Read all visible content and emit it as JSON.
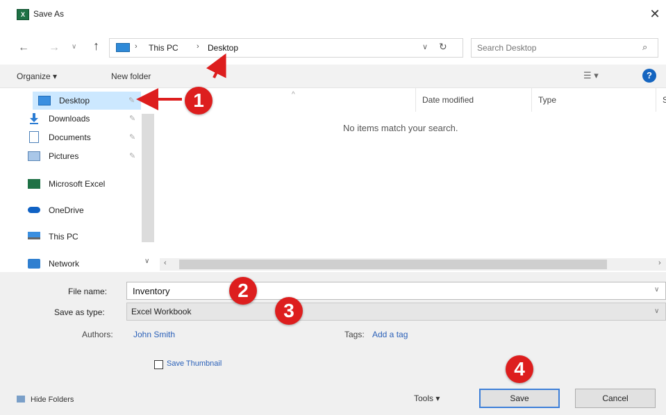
{
  "window": {
    "title": "Save As",
    "close_glyph": "✕",
    "app_icon_text": "X"
  },
  "address": {
    "back_glyph": "←",
    "forward_glyph": "→",
    "recent_glyph": "∨",
    "up_glyph": "↑",
    "crumb_sep": "›",
    "crumbs": [
      "This PC",
      "Desktop"
    ],
    "dropdown_glyph": "∨",
    "refresh_glyph": "↻"
  },
  "search": {
    "placeholder": "Search Desktop",
    "icon_glyph": "⌕"
  },
  "toolbar": {
    "organize_label": "Organize ▾",
    "new_folder_label": "New folder",
    "view_glyph": "☰ ▾",
    "help_glyph": "?"
  },
  "nav_pane": {
    "items": [
      {
        "label": "Desktop",
        "icon": "desktop-icon",
        "pinned": true
      },
      {
        "label": "Downloads",
        "icon": "download-icon",
        "pinned": true
      },
      {
        "label": "Documents",
        "icon": "documents-icon",
        "pinned": true
      },
      {
        "label": "Pictures",
        "icon": "pictures-icon",
        "pinned": true
      },
      {
        "label": "Microsoft Excel",
        "icon": "excel-icon",
        "pinned": false
      },
      {
        "label": "OneDrive",
        "icon": "onedrive-icon",
        "pinned": false
      },
      {
        "label": "This PC",
        "icon": "computer-icon",
        "pinned": false
      },
      {
        "label": "Network",
        "icon": "network-icon",
        "pinned": false
      }
    ],
    "pin_glyph": "✎",
    "scroll_down_glyph": "∨"
  },
  "file_list": {
    "sort_arrow": "^",
    "columns": [
      "Date modified",
      "Type",
      "Size"
    ],
    "empty_message": "No items match your search.",
    "scroll_left_glyph": "‹",
    "scroll_right_glyph": "›"
  },
  "form": {
    "filename_label": "File name:",
    "filename_value": "Inventory",
    "savetype_label": "Save as type:",
    "savetype_value": "Excel Workbook",
    "dropdown_glyph": "∨",
    "authors_label": "Authors:",
    "authors_value": "John Smith",
    "tags_label": "Tags:",
    "tags_value": "Add a tag",
    "thumbnail_label": "Save Thumbnail"
  },
  "footer": {
    "hide_folders_label": "Hide Folders",
    "tools_label": "Tools  ▾",
    "save_label": "Save",
    "cancel_label": "Cancel"
  },
  "annotations": [
    "1",
    "2",
    "3",
    "4"
  ],
  "colors": {
    "callout": "#dd1e1e",
    "selection": "#cce8ff",
    "link": "#2a60b8",
    "excel_green": "#1e7145"
  }
}
